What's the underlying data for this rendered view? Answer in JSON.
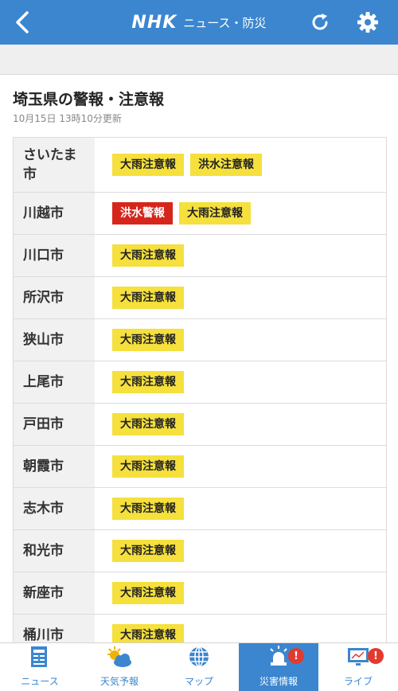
{
  "header": {
    "brand": "NHK",
    "section_title": "ニュース・防災"
  },
  "page": {
    "title": "埼玉県の警報・注意報",
    "updated": "10月15日 13時10分更新"
  },
  "rows": [
    {
      "city": "さいたま市",
      "warnings": [
        {
          "label": "大雨注意報",
          "level": "advisory"
        },
        {
          "label": "洪水注意報",
          "level": "advisory"
        }
      ]
    },
    {
      "city": "川越市",
      "warnings": [
        {
          "label": "洪水警報",
          "level": "warning"
        },
        {
          "label": "大雨注意報",
          "level": "advisory"
        }
      ]
    },
    {
      "city": "川口市",
      "warnings": [
        {
          "label": "大雨注意報",
          "level": "advisory"
        }
      ]
    },
    {
      "city": "所沢市",
      "warnings": [
        {
          "label": "大雨注意報",
          "level": "advisory"
        }
      ]
    },
    {
      "city": "狭山市",
      "warnings": [
        {
          "label": "大雨注意報",
          "level": "advisory"
        }
      ]
    },
    {
      "city": "上尾市",
      "warnings": [
        {
          "label": "大雨注意報",
          "level": "advisory"
        }
      ]
    },
    {
      "city": "戸田市",
      "warnings": [
        {
          "label": "大雨注意報",
          "level": "advisory"
        }
      ]
    },
    {
      "city": "朝霞市",
      "warnings": [
        {
          "label": "大雨注意報",
          "level": "advisory"
        }
      ]
    },
    {
      "city": "志木市",
      "warnings": [
        {
          "label": "大雨注意報",
          "level": "advisory"
        }
      ]
    },
    {
      "city": "和光市",
      "warnings": [
        {
          "label": "大雨注意報",
          "level": "advisory"
        }
      ]
    },
    {
      "city": "新座市",
      "warnings": [
        {
          "label": "大雨注意報",
          "level": "advisory"
        }
      ]
    },
    {
      "city": "桶川市",
      "warnings": [
        {
          "label": "大雨注意報",
          "level": "advisory"
        }
      ]
    }
  ],
  "nav": {
    "items": [
      {
        "label": "ニュース",
        "icon": "newspaper-icon",
        "active": false,
        "alert": ""
      },
      {
        "label": "天気予報",
        "icon": "weather-icon",
        "active": false,
        "alert": ""
      },
      {
        "label": "マップ",
        "icon": "globe-icon",
        "active": false,
        "alert": ""
      },
      {
        "label": "災害情報",
        "icon": "siren-icon",
        "active": true,
        "alert": "!"
      },
      {
        "label": "ライブ",
        "icon": "live-tv-icon",
        "active": false,
        "alert": "!"
      }
    ]
  },
  "colors": {
    "brand_blue": "#3b86cf",
    "advisory_yellow": "#f5e03d",
    "warning_red": "#d6261c",
    "alert_red": "#e23a2f"
  }
}
